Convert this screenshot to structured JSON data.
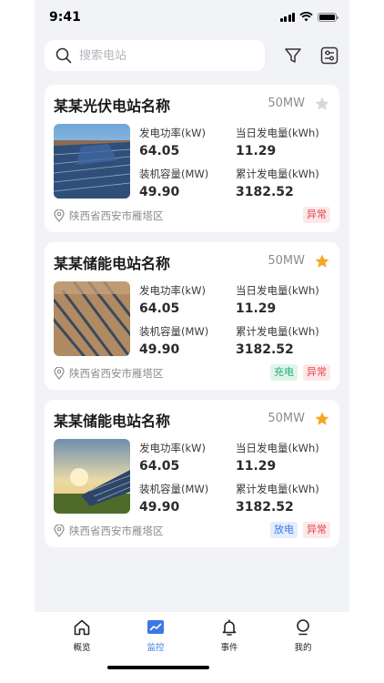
{
  "status_bar": {
    "time": "9:41"
  },
  "search": {
    "placeholder": "搜索电站",
    "value": ""
  },
  "stations": [
    {
      "name": "某某光伏电站名称",
      "capacity": "50MW",
      "favorited": false,
      "metrics": [
        {
          "label": "发电功率(kW)",
          "value": "64.05"
        },
        {
          "label": "当日发电量(kWh)",
          "value": "11.29"
        },
        {
          "label": "装机容量(MW)",
          "value": "49.90"
        },
        {
          "label": "累计发电量(kWh)",
          "value": "3182.52"
        }
      ],
      "location": "陕西省西安市雁塔区",
      "tags": [
        {
          "label": "异常",
          "kind": "abnormal"
        }
      ]
    },
    {
      "name": "某某储能电站名称",
      "capacity": "50MW",
      "favorited": true,
      "metrics": [
        {
          "label": "发电功率(kW)",
          "value": "64.05"
        },
        {
          "label": "当日发电量(kWh)",
          "value": "11.29"
        },
        {
          "label": "装机容量(MW)",
          "value": "49.90"
        },
        {
          "label": "累计发电量(kWh)",
          "value": "3182.52"
        }
      ],
      "location": "陕西省西安市雁塔区",
      "tags": [
        {
          "label": "充电",
          "kind": "charge"
        },
        {
          "label": "异常",
          "kind": "abnormal"
        }
      ]
    },
    {
      "name": "某某储能电站名称",
      "capacity": "50MW",
      "favorited": true,
      "metrics": [
        {
          "label": "发电功率(kW)",
          "value": "64.05"
        },
        {
          "label": "当日发电量(kWh)",
          "value": "11.29"
        },
        {
          "label": "装机容量(MW)",
          "value": "49.90"
        },
        {
          "label": "累计发电量(kWh)",
          "value": "3182.52"
        }
      ],
      "location": "陕西省西安市雁塔区",
      "tags": [
        {
          "label": "放电",
          "kind": "discharge"
        },
        {
          "label": "异常",
          "kind": "abnormal"
        }
      ]
    }
  ],
  "tabbar": {
    "items": [
      {
        "label": "概览",
        "icon": "home-icon",
        "active": false
      },
      {
        "label": "监控",
        "icon": "monitor-chart-icon",
        "active": true
      },
      {
        "label": "事件",
        "icon": "bell-icon",
        "active": false
      },
      {
        "label": "我的",
        "icon": "user-icon",
        "active": false
      }
    ]
  },
  "colors": {
    "accent": "#3a78e6",
    "star_active": "#f5a623",
    "star_inactive": "#d6d7db",
    "abnormal": "#e5484d",
    "charge": "#1fae72",
    "discharge": "#3b7be8"
  }
}
